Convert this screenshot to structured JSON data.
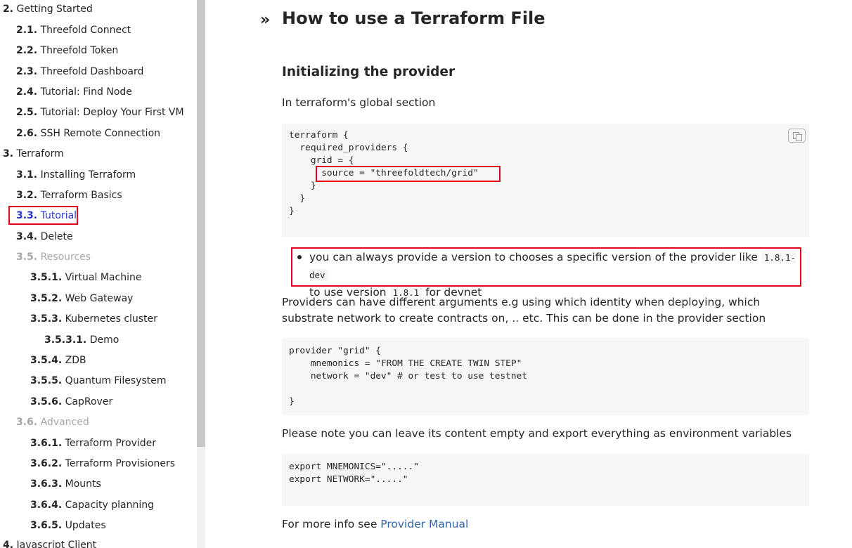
{
  "sidebar": {
    "items": [
      {
        "num": "2.",
        "label": "Getting Started",
        "state": "normal"
      },
      {
        "num": "2.1.",
        "label": "Threefold Connect",
        "state": "normal"
      },
      {
        "num": "2.2.",
        "label": "Threefold Token",
        "state": "normal"
      },
      {
        "num": "2.3.",
        "label": "Threefold Dashboard",
        "state": "normal"
      },
      {
        "num": "2.4.",
        "label": "Tutorial: Find Node",
        "state": "normal"
      },
      {
        "num": "2.5.",
        "label": "Tutorial: Deploy Your First VM",
        "state": "normal"
      },
      {
        "num": "2.6.",
        "label": "SSH Remote Connection",
        "state": "normal"
      },
      {
        "num": "3.",
        "label": "Terraform",
        "state": "normal"
      },
      {
        "num": "3.1.",
        "label": "Installing Terraform",
        "state": "normal"
      },
      {
        "num": "3.2.",
        "label": "Terraform Basics",
        "state": "normal"
      },
      {
        "num": "3.3.",
        "label": "Tutorial",
        "state": "active"
      },
      {
        "num": "3.4.",
        "label": "Delete",
        "state": "normal"
      },
      {
        "num": "3.5.",
        "label": "Resources",
        "state": "muted"
      },
      {
        "num": "3.5.1.",
        "label": "Virtual Machine",
        "state": "normal"
      },
      {
        "num": "3.5.2.",
        "label": "Web Gateway",
        "state": "normal"
      },
      {
        "num": "3.5.3.",
        "label": "Kubernetes cluster",
        "state": "normal"
      },
      {
        "num": "3.5.3.1.",
        "label": "Demo",
        "state": "normal"
      },
      {
        "num": "3.5.4.",
        "label": "ZDB",
        "state": "normal"
      },
      {
        "num": "3.5.5.",
        "label": "Quantum Filesystem",
        "state": "normal"
      },
      {
        "num": "3.5.6.",
        "label": "CapRover",
        "state": "normal"
      },
      {
        "num": "3.6.",
        "label": "Advanced",
        "state": "muted"
      },
      {
        "num": "3.6.1.",
        "label": "Terraform Provider",
        "state": "normal"
      },
      {
        "num": "3.6.2.",
        "label": "Terraform Provisioners",
        "state": "normal"
      },
      {
        "num": "3.6.3.",
        "label": "Mounts",
        "state": "normal"
      },
      {
        "num": "3.6.4.",
        "label": "Capacity planning",
        "state": "normal"
      },
      {
        "num": "3.6.5.",
        "label": "Updates",
        "state": "normal"
      },
      {
        "num": "4.",
        "label": "Javascript Client",
        "state": "normal"
      }
    ]
  },
  "main": {
    "chevron": "»",
    "title": "How to use a Terraform File",
    "section_heading": "Initializing the provider",
    "intro": "In terraform's global section",
    "code1": [
      "terraform {",
      "  required_providers {",
      "    grid = {",
      "      source = \"threefoldtech/grid\"",
      "    }",
      "  }",
      "}"
    ],
    "note": {
      "text1": "you can always provide a version to chooses a specific version of the provider like ",
      "code1": "1.8.1-dev",
      "text2": "to use version ",
      "code2": "1.8.1",
      "text3": " for devnet"
    },
    "providers_para": "Providers can have different arguments e.g using which identity when deploying, which substrate network to create contracts on, .. etc. This can be done in the provider section",
    "code2": [
      "provider \"grid\" {",
      "    mnemonics = \"FROM THE CREATE TWIN STEP\"",
      "    network = \"dev\" # or test to use testnet",
      "",
      "}"
    ],
    "env_para": "Please note you can leave its content empty and export everything as environment variables",
    "code3": [
      "export MNEMONICS=\".....\"",
      "export NETWORK=\".....\""
    ],
    "more_info_prefix": "For more info see ",
    "more_info_link": "Provider Manual"
  },
  "colors": {
    "highlight": "#e3001b",
    "active_nav": "#2a3bd4",
    "link": "#3366aa",
    "code_bg": "#f6f6f6"
  }
}
